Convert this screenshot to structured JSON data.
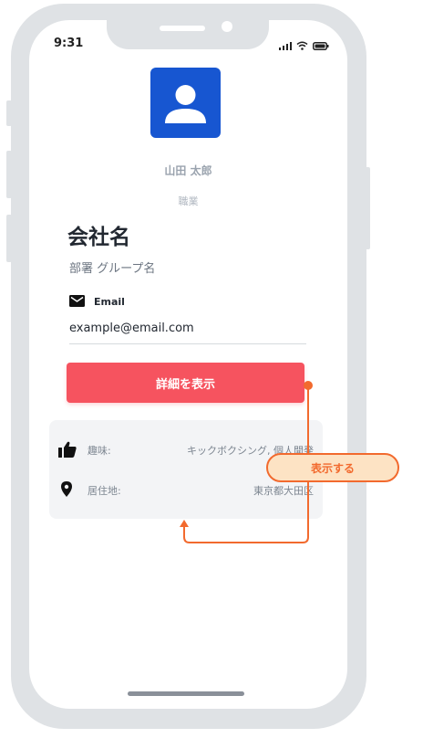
{
  "status_bar": {
    "time": "9:31"
  },
  "profile": {
    "name": "山田 太郎",
    "job": "職業",
    "company": "会社名",
    "department": "部署 グループ名"
  },
  "email": {
    "label": "Email",
    "value": "example@email.com"
  },
  "detail_button": {
    "label": "詳細を表示"
  },
  "details": {
    "hobby": {
      "label": "趣味:",
      "value": "キックボクシング, 個人開発",
      "icon": "thumbs-up-icon"
    },
    "residence": {
      "label": "居住地:",
      "value": "東京都大田区",
      "icon": "location-pin-icon"
    }
  },
  "annotation": {
    "label": "表示する"
  },
  "colors": {
    "accent": "#f6535f",
    "avatar": "#1756d1",
    "annotation": "#f26a2e",
    "annotation_fill": "#fde3c4",
    "frame": "#dfe2e5",
    "card": "#f3f4f6"
  }
}
